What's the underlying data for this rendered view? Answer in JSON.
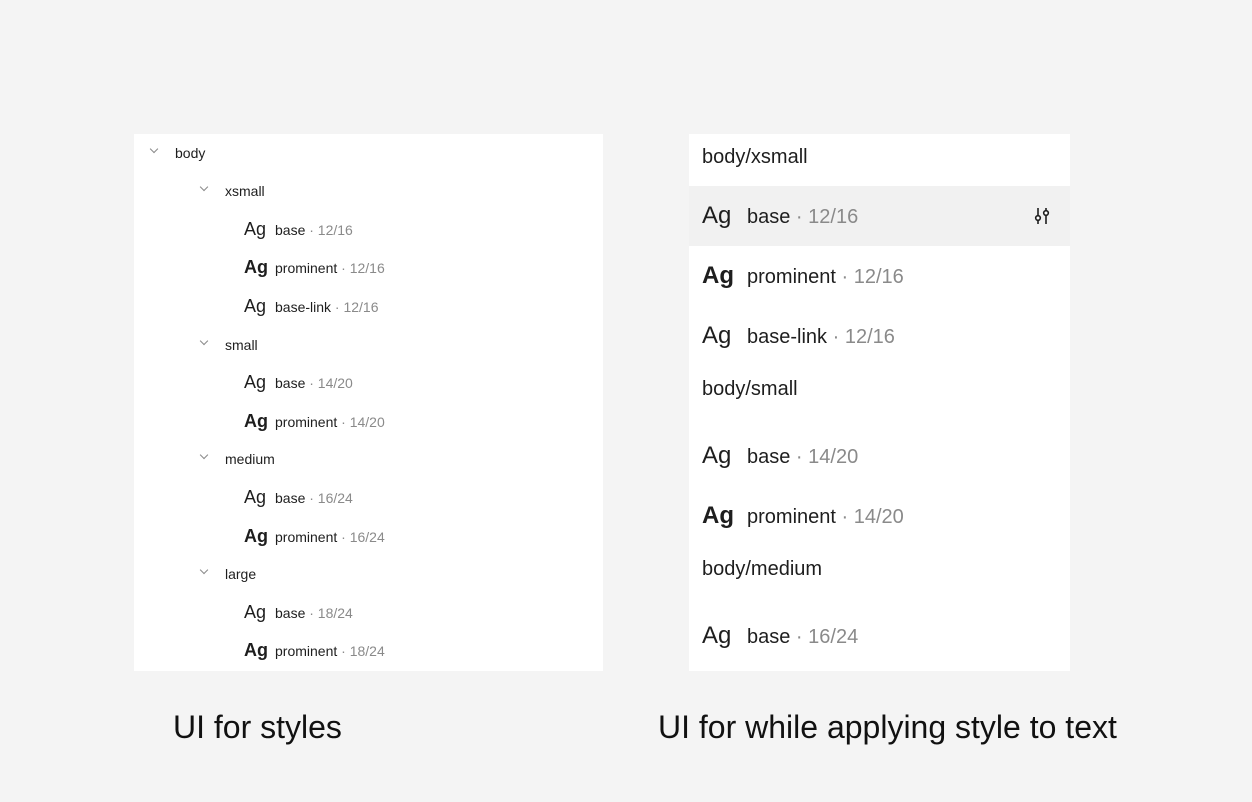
{
  "tree": {
    "root_label": "body",
    "groups": [
      {
        "label": "xsmall",
        "styles": [
          {
            "ag": "Ag",
            "name": "base",
            "meta": " · 12/16",
            "bold": false
          },
          {
            "ag": "Ag",
            "name": "prominent",
            "meta": " · 12/16",
            "bold": true
          },
          {
            "ag": "Ag",
            "name": "base-link",
            "meta": " · 12/16",
            "bold": false
          }
        ]
      },
      {
        "label": "small",
        "styles": [
          {
            "ag": "Ag",
            "name": "base",
            "meta": " · 14/20",
            "bold": false
          },
          {
            "ag": "Ag",
            "name": "prominent",
            "meta": " · 14/20",
            "bold": true
          }
        ]
      },
      {
        "label": "medium",
        "styles": [
          {
            "ag": "Ag",
            "name": "base",
            "meta": " · 16/24",
            "bold": false
          },
          {
            "ag": "Ag",
            "name": "prominent",
            "meta": " · 16/24",
            "bold": true
          }
        ]
      },
      {
        "label": "large",
        "styles": [
          {
            "ag": "Ag",
            "name": "base",
            "meta": " · 18/24",
            "bold": false
          },
          {
            "ag": "Ag",
            "name": "prominent",
            "meta": " · 18/24",
            "bold": true
          }
        ]
      }
    ]
  },
  "picker": {
    "rows": [
      {
        "type": "header",
        "label": "body/xsmall"
      },
      {
        "type": "style",
        "ag": "Ag",
        "name": "base",
        "meta": " · 12/16",
        "bold": false,
        "hover": true,
        "icon": "adjust-sliders-icon"
      },
      {
        "type": "style",
        "ag": "Ag",
        "name": "prominent",
        "meta": " · 12/16",
        "bold": true
      },
      {
        "type": "style",
        "ag": "Ag",
        "name": "base-link",
        "meta": " · 12/16",
        "bold": false
      },
      {
        "type": "header",
        "label": "body/small"
      },
      {
        "type": "style",
        "ag": "Ag",
        "name": "base",
        "meta": " · 14/20",
        "bold": false
      },
      {
        "type": "style",
        "ag": "Ag",
        "name": "prominent",
        "meta": " · 14/20",
        "bold": true
      },
      {
        "type": "header",
        "label": "body/medium"
      },
      {
        "type": "style",
        "ag": "Ag",
        "name": "base",
        "meta": " · 16/24",
        "bold": false
      }
    ]
  },
  "captions": {
    "left": "UI for styles",
    "right": "UI for while applying style to text"
  },
  "colors": {
    "background": "#f4f4f4",
    "panel": "#ffffff",
    "hover_row": "#f1f1f1",
    "text": "#1e1e1e",
    "muted_text": "#8a8a8a"
  }
}
